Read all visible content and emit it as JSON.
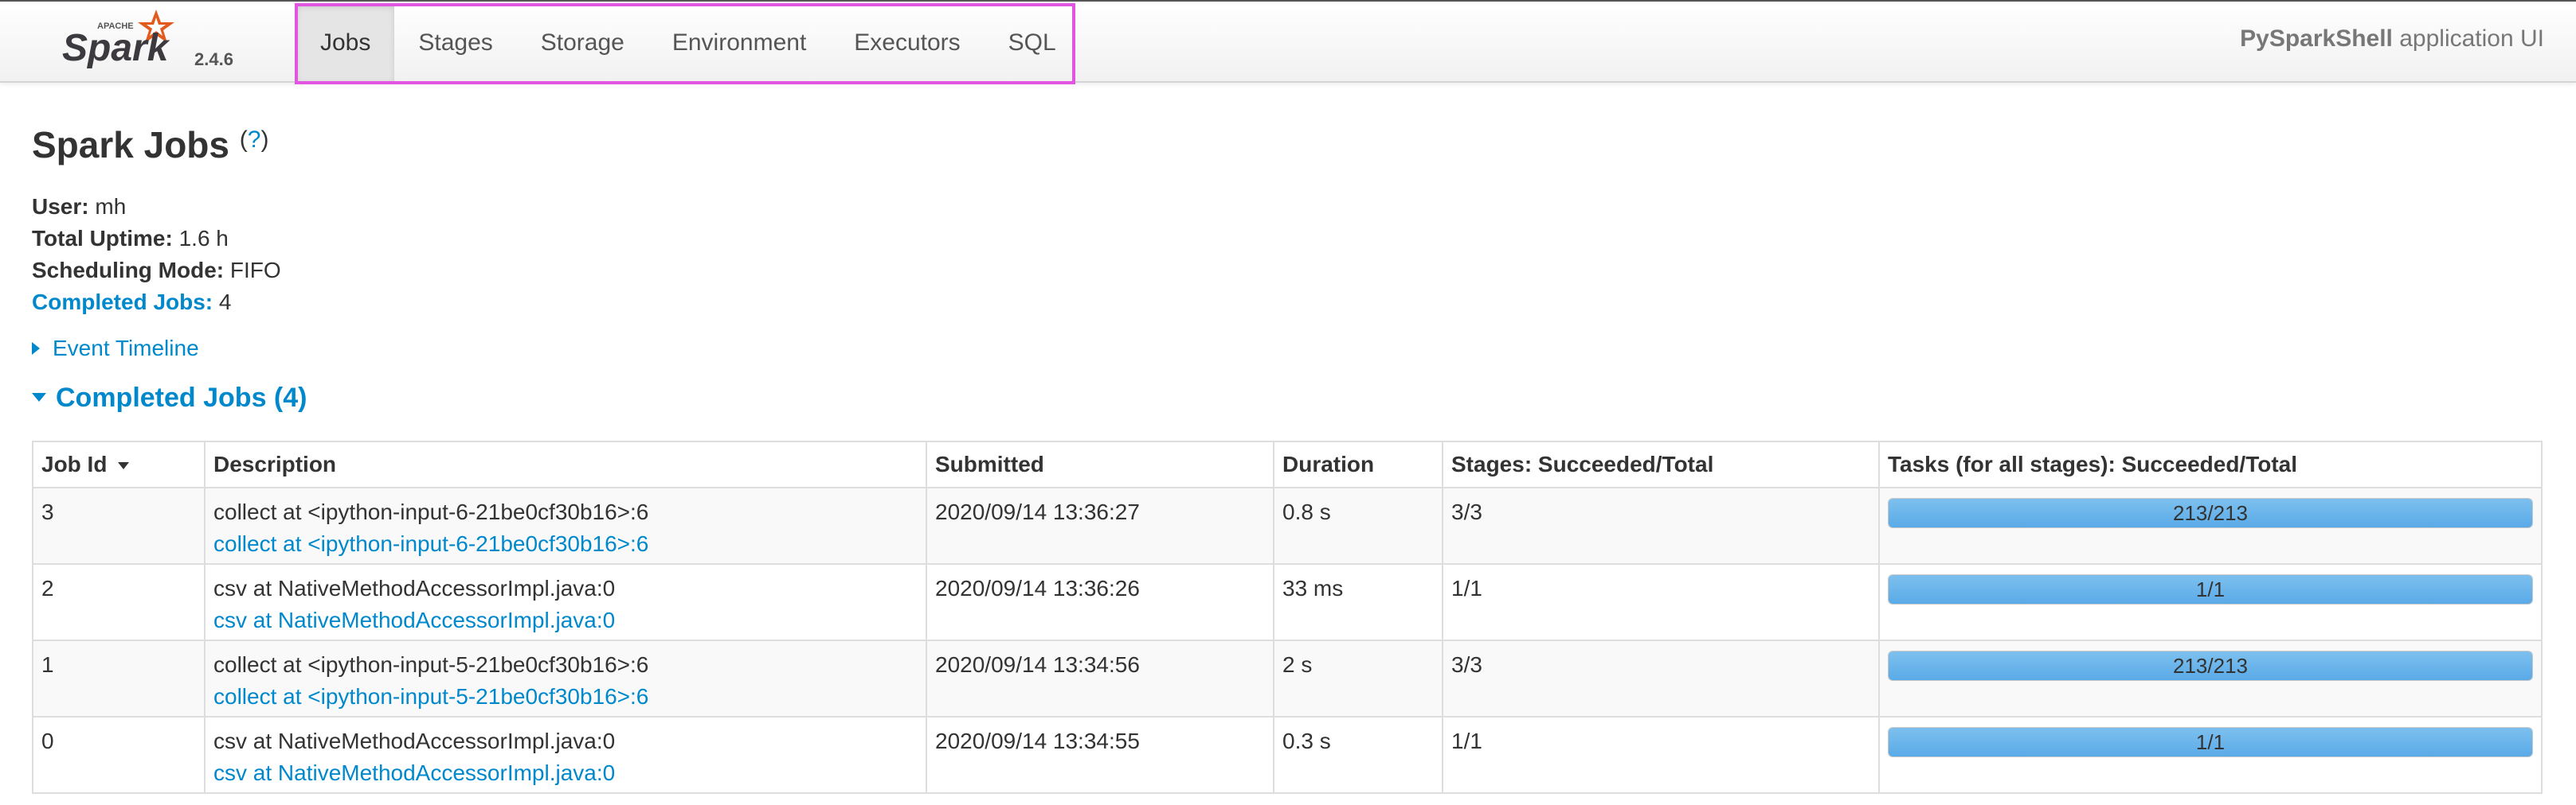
{
  "header": {
    "logo_small_text": "APACHE",
    "logo_text": "Spark",
    "version": "2.4.6",
    "tabs": [
      {
        "label": "Jobs",
        "active": true
      },
      {
        "label": "Stages",
        "active": false
      },
      {
        "label": "Storage",
        "active": false
      },
      {
        "label": "Environment",
        "active": false
      },
      {
        "label": "Executors",
        "active": false
      },
      {
        "label": "SQL",
        "active": false
      }
    ],
    "app_name": "PySparkShell",
    "app_suffix": " application UI"
  },
  "page": {
    "title": "Spark Jobs",
    "help": "?",
    "summary": {
      "user_label": "User:",
      "user_value": " mh",
      "uptime_label": "Total Uptime:",
      "uptime_value": " 1.6 h",
      "mode_label": "Scheduling Mode:",
      "mode_value": " FIFO",
      "completed_label": "Completed Jobs:",
      "completed_value": " 4"
    },
    "event_timeline": "Event Timeline",
    "completed_section": "Completed Jobs (4)"
  },
  "table": {
    "headers": [
      "Job Id",
      "Description",
      "Submitted",
      "Duration",
      "Stages: Succeeded/Total",
      "Tasks (for all stages): Succeeded/Total"
    ],
    "rows": [
      {
        "id": "3",
        "desc": "collect at <ipython-input-6-21be0cf30b16>:6",
        "link": "collect at <ipython-input-6-21be0cf30b16>:6",
        "submitted": "2020/09/14 13:36:27",
        "duration": "0.8 s",
        "stages": "3/3",
        "tasks": "213/213",
        "progress": 1.0
      },
      {
        "id": "2",
        "desc": "csv at NativeMethodAccessorImpl.java:0",
        "link": "csv at NativeMethodAccessorImpl.java:0",
        "submitted": "2020/09/14 13:36:26",
        "duration": "33 ms",
        "stages": "1/1",
        "tasks": "1/1",
        "progress": 1.0
      },
      {
        "id": "1",
        "desc": "collect at <ipython-input-5-21be0cf30b16>:6",
        "link": "collect at <ipython-input-5-21be0cf30b16>:6",
        "submitted": "2020/09/14 13:34:56",
        "duration": "2 s",
        "stages": "3/3",
        "tasks": "213/213",
        "progress": 1.0
      },
      {
        "id": "0",
        "desc": "csv at NativeMethodAccessorImpl.java:0",
        "link": "csv at NativeMethodAccessorImpl.java:0",
        "submitted": "2020/09/14 13:34:55",
        "duration": "0.3 s",
        "stages": "1/1",
        "tasks": "1/1",
        "progress": 1.0
      }
    ]
  },
  "colors": {
    "link": "#0088cc",
    "progress_fill": "#5aaae8",
    "nav_highlight": "#e056e0",
    "spark_star": "#e25a1c"
  }
}
